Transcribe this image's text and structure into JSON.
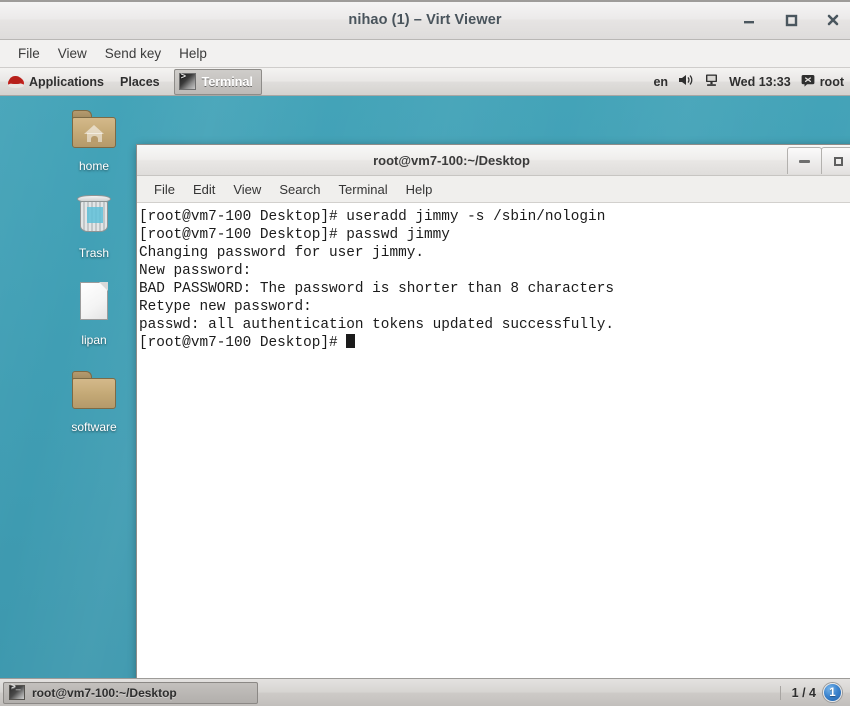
{
  "viewer": {
    "title": "nihao (1) – Virt Viewer",
    "menu": [
      "File",
      "View",
      "Send key",
      "Help"
    ],
    "window_buttons": {
      "minimize": "minimize-icon",
      "maximize": "maximize-icon",
      "close": "close-icon"
    }
  },
  "guest": {
    "panel": {
      "logo_icon": "redhat-logo-icon",
      "applications": "Applications",
      "places": "Places",
      "active_task": "Terminal",
      "active_task_icon": "terminal-icon",
      "keyboard_layout": "en",
      "volume_icon": "speaker-icon",
      "network_icon": "network-display-icon",
      "clock": "Wed 13:33",
      "message_icon": "message-icon",
      "user": "root"
    },
    "desktop": {
      "background_color": "#3f9db3",
      "icons": [
        {
          "label": "home",
          "icon": "home-folder-icon",
          "type": "folder-home"
        },
        {
          "label": "Trash",
          "icon": "trash-icon",
          "type": "trash"
        },
        {
          "label": "lipan",
          "icon": "document-icon",
          "type": "document"
        },
        {
          "label": "software",
          "icon": "folder-icon",
          "type": "folder"
        }
      ]
    },
    "taskbar": {
      "items": [
        {
          "label": "root@vm7-100:~/Desktop",
          "icon": "terminal-icon"
        }
      ],
      "workspace_indicator": "1 / 4",
      "workspace_badge": "1"
    }
  },
  "terminal": {
    "title": "root@vm7-100:~/Desktop",
    "menu": [
      "File",
      "Edit",
      "View",
      "Search",
      "Terminal",
      "Help"
    ],
    "window_buttons": {
      "minimize": "minimize-icon",
      "maximize": "maximize-icon"
    },
    "lines": [
      "[root@vm7-100 Desktop]# useradd jimmy -s /sbin/nologin",
      "[root@vm7-100 Desktop]# passwd jimmy",
      "Changing password for user jimmy.",
      "New password:",
      "BAD PASSWORD: The password is shorter than 8 characters",
      "Retype new password:",
      "passwd: all authentication tokens updated successfully."
    ],
    "prompt": "[root@vm7-100 Desktop]# ",
    "cursor": "block"
  }
}
